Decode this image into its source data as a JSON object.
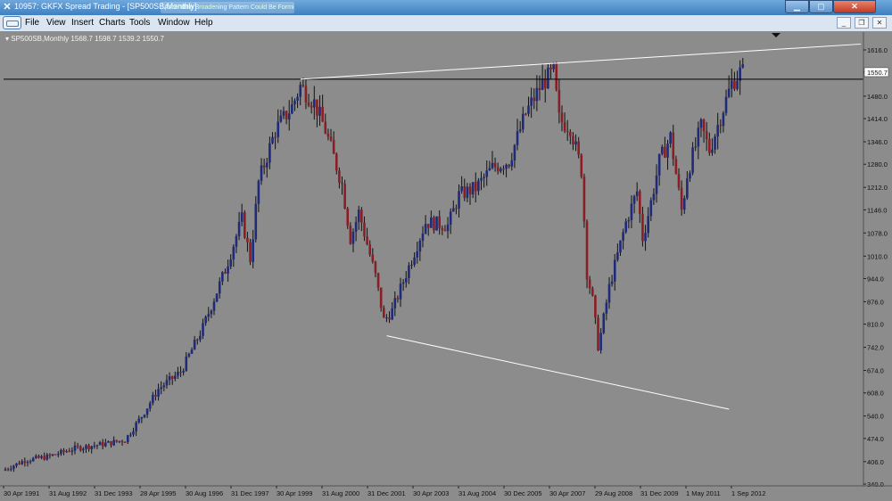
{
  "window": {
    "title": "10957: GKFX Spread Trading - [SP500SB,Monthly]",
    "ghost_tab": "Ascending Broadening Pattern Could Be Forming ...",
    "app_icon": "x-logo-icon"
  },
  "menu": {
    "items": [
      "File",
      "View",
      "Insert",
      "Charts",
      "Tools",
      "Window",
      "Help"
    ]
  },
  "chart_header": {
    "symbol": "SP500SB,Monthly",
    "ohlc": "1568.7 1598.7 1539.2 1550.7"
  },
  "colors": {
    "background": "#8c8c8c",
    "bull_candle": "#1f2a7a",
    "bear_candle": "#8b1e24",
    "trendline": "#ffffff",
    "horizontal_line": "#000000",
    "price_marker": "#ffffff"
  },
  "chart_data": {
    "type": "candlestick",
    "current_price": 1550.7,
    "y_ticks": [
      1616.0,
      1550.7,
      1480.0,
      1414.0,
      1346.0,
      1280.0,
      1212.0,
      1146.0,
      1078.0,
      1010.0,
      944.0,
      876.0,
      810.0,
      742.0,
      674.0,
      608.0,
      540.0,
      474.0,
      406.0,
      340.0
    ],
    "y_tick_labels": [
      "1616.0",
      "1550.7",
      "1480.0",
      "1414.0",
      "1346.0",
      "1280.0",
      "1212.0",
      "1146.0",
      "1078.0",
      "1010.0",
      "944.0",
      "876.0",
      "810.0",
      "742.0",
      "674.0",
      "608.0",
      "540.0",
      "474.0",
      "406.0",
      "340.0"
    ],
    "x_tick_labels": [
      "30 Apr 1991",
      "31 Aug 1992",
      "31 Dec 1993",
      "28 Apr 1995",
      "30 Aug 1996",
      "31 Dec 1997",
      "30 Apr 1999",
      "31 Aug 2000",
      "31 Dec 2001",
      "30 Apr 2003",
      "31 Aug 2004",
      "30 Dec 2005",
      "30 Apr 2007",
      "29 Aug 2008",
      "31 Dec 2009",
      "1 May 2011",
      "1 Sep 2012"
    ],
    "x_range_years": [
      1991.33,
      2013.5
    ],
    "ylim": [
      340,
      1650
    ],
    "price_path": [
      [
        1991.33,
        380
      ],
      [
        1992.0,
        410
      ],
      [
        1992.67,
        420
      ],
      [
        1993.5,
        445
      ],
      [
        1994.5,
        460
      ],
      [
        1995.0,
        470
      ],
      [
        1995.5,
        540
      ],
      [
        1996.0,
        620
      ],
      [
        1996.67,
        670
      ],
      [
        1997.33,
        800
      ],
      [
        1998.0,
        970
      ],
      [
        1998.5,
        1120
      ],
      [
        1998.75,
        1000
      ],
      [
        1999.0,
        1230
      ],
      [
        1999.5,
        1380
      ],
      [
        2000.0,
        1450
      ],
      [
        2000.25,
        1510
      ],
      [
        2000.67,
        1460
      ],
      [
        2001.0,
        1380
      ],
      [
        2001.5,
        1220
      ],
      [
        2001.75,
        1060
      ],
      [
        2002.0,
        1140
      ],
      [
        2002.5,
        950
      ],
      [
        2002.75,
        820
      ],
      [
        2003.0,
        850
      ],
      [
        2003.5,
        980
      ],
      [
        2004.0,
        1110
      ],
      [
        2004.67,
        1100
      ],
      [
        2005.0,
        1190
      ],
      [
        2005.5,
        1210
      ],
      [
        2006.0,
        1270
      ],
      [
        2006.5,
        1290
      ],
      [
        2007.0,
        1430
      ],
      [
        2007.5,
        1520
      ],
      [
        2007.83,
        1550
      ],
      [
        2008.0,
        1410
      ],
      [
        2008.33,
        1390
      ],
      [
        2008.67,
        1260
      ],
      [
        2008.83,
        960
      ],
      [
        2009.0,
        880
      ],
      [
        2009.17,
        740
      ],
      [
        2009.5,
        920
      ],
      [
        2010.0,
        1110
      ],
      [
        2010.33,
        1200
      ],
      [
        2010.5,
        1060
      ],
      [
        2010.75,
        1170
      ],
      [
        2011.0,
        1290
      ],
      [
        2011.33,
        1360
      ],
      [
        2011.67,
        1140
      ],
      [
        2011.83,
        1250
      ],
      [
        2012.25,
        1390
      ],
      [
        2012.5,
        1320
      ],
      [
        2012.83,
        1420
      ],
      [
        2013.17,
        1520
      ],
      [
        2013.42,
        1550.7
      ]
    ],
    "trendlines": [
      {
        "kind": "resistance",
        "from": [
          2000.17,
          1530
        ],
        "to": [
          2013.5,
          1612
        ]
      },
      {
        "kind": "support",
        "from": [
          2002.75,
          776
        ],
        "to": [
          2013.0,
          560
        ]
      }
    ],
    "horizontal_level": 1530,
    "grid": false
  }
}
